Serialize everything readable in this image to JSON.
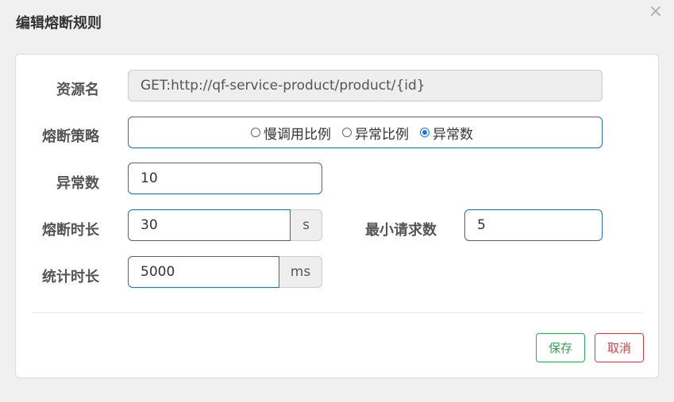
{
  "dialog": {
    "title": "编辑熔断规则",
    "close": "×"
  },
  "form": {
    "resource": {
      "label": "资源名",
      "value": "GET:http://qf-service-product/product/{id}"
    },
    "strategy": {
      "label": "熔断策略",
      "options": [
        "慢调用比例",
        "异常比例",
        "异常数"
      ],
      "selected": "异常数"
    },
    "count": {
      "label": "异常数",
      "value": "10"
    },
    "duration": {
      "label": "熔断时长",
      "value": "30",
      "unit": "s"
    },
    "min_requests": {
      "label": "最小请求数",
      "value": "5"
    },
    "stat_interval": {
      "label": "统计时长",
      "value": "5000",
      "unit": "ms"
    }
  },
  "buttons": {
    "save": "保存",
    "cancel": "取消"
  },
  "colors": {
    "accent_border": "#2b6fa5",
    "save": "#3aa15a",
    "cancel": "#c9444d",
    "radio_selected": "#1a73e8"
  }
}
